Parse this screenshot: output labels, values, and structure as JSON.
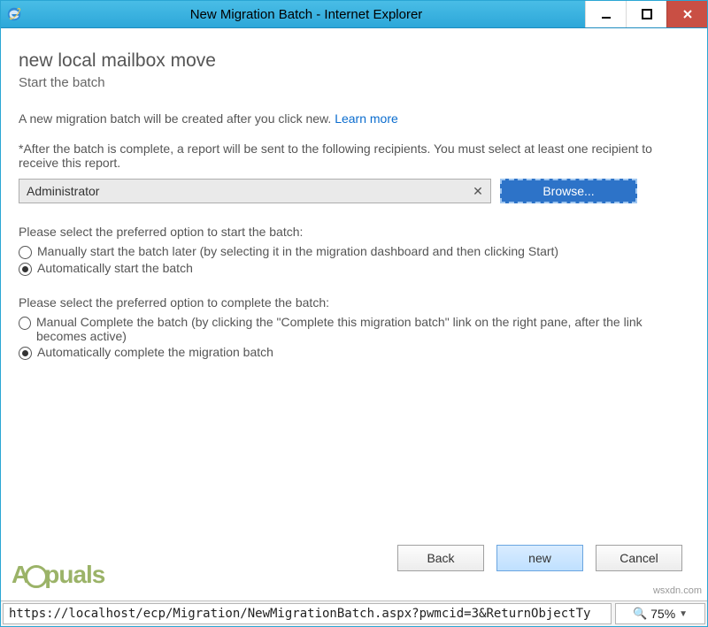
{
  "titlebar": {
    "title": "New Migration Batch - Internet Explorer"
  },
  "content": {
    "heading": "new local mailbox move",
    "subheading": "Start the batch",
    "info_prefix": "A new migration batch will be created after you click new. ",
    "info_link": "Learn more",
    "report_note": "*After the batch is complete, a report will be sent to the following recipients. You must select at least one recipient to receive this report.",
    "recipient_value": "Administrator",
    "browse_label": "Browse...",
    "start_group": {
      "title": "Please select the preferred option to start the batch:",
      "options": [
        {
          "label": "Manually start the batch later (by selecting it in the migration dashboard and then clicking Start)",
          "selected": false
        },
        {
          "label": "Automatically start the batch",
          "selected": true
        }
      ]
    },
    "complete_group": {
      "title": "Please select the preferred option to complete the batch:",
      "options": [
        {
          "label": "Manual Complete the batch (by clicking the \"Complete this migration batch\" link on the right pane, after the link becomes active)",
          "selected": false
        },
        {
          "label": "Automatically complete the migration batch",
          "selected": true
        }
      ]
    }
  },
  "footer": {
    "back": "Back",
    "new": "new",
    "cancel": "Cancel"
  },
  "statusbar": {
    "url": "https://localhost/ecp/Migration/NewMigrationBatch.aspx?pwmcid=3&ReturnObjectTy",
    "zoom": "75%"
  },
  "watermarks": {
    "logo_text_a": "A",
    "logo_text_b": "puals",
    "site": "wsxdn.com"
  }
}
